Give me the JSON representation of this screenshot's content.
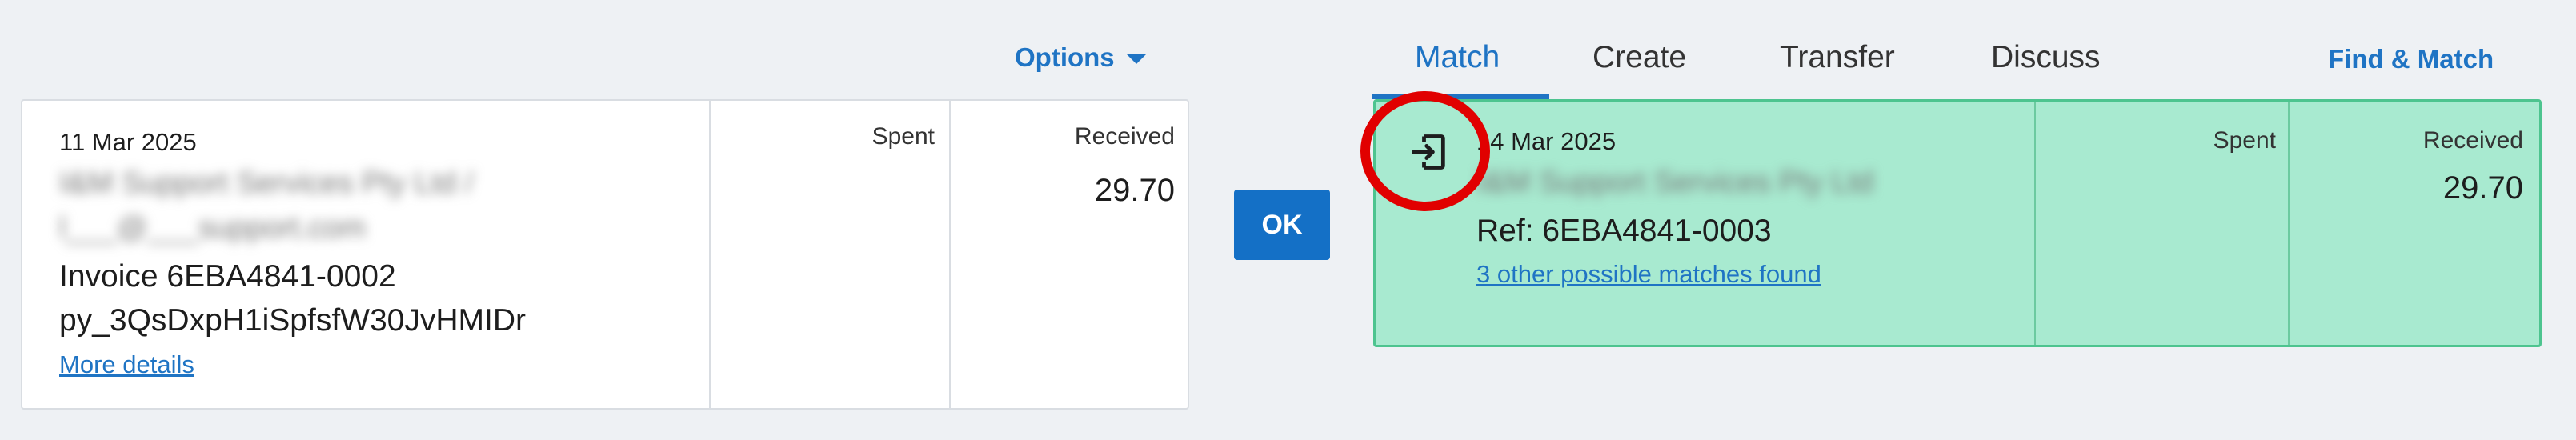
{
  "options": {
    "label": "Options"
  },
  "statement": {
    "date": "11 Mar 2025",
    "payee_line": "I&M Support Services Pty Ltd /",
    "email_line": "l___@___support.com",
    "invoice": "Invoice 6EBA4841-0002",
    "reference": "py_3QsDxpH1iSpfsfW30JvHMIDr",
    "more_details": "More details",
    "spent_label": "Spent",
    "received_label": "Received",
    "received_value": "29.70"
  },
  "ok_button": {
    "label": "OK"
  },
  "tabs": [
    {
      "label": "Match",
      "active": true
    },
    {
      "label": "Create",
      "active": false
    },
    {
      "label": "Transfer",
      "active": false
    },
    {
      "label": "Discuss",
      "active": false
    }
  ],
  "find_match": {
    "label": "Find & Match"
  },
  "match": {
    "date": "14 Mar 2025",
    "payee_line": "I&M Support Services Pty Ltd",
    "reference": "Ref: 6EBA4841-0003",
    "other_matches": "3 other possible matches found",
    "spent_label": "Spent",
    "received_label": "Received",
    "received_value": "29.70"
  },
  "colors": {
    "accent": "#1f74c4",
    "match_bg": "#a8ead0",
    "highlight_ring": "#e10000"
  },
  "icons": {
    "match_icon": "import-icon"
  }
}
